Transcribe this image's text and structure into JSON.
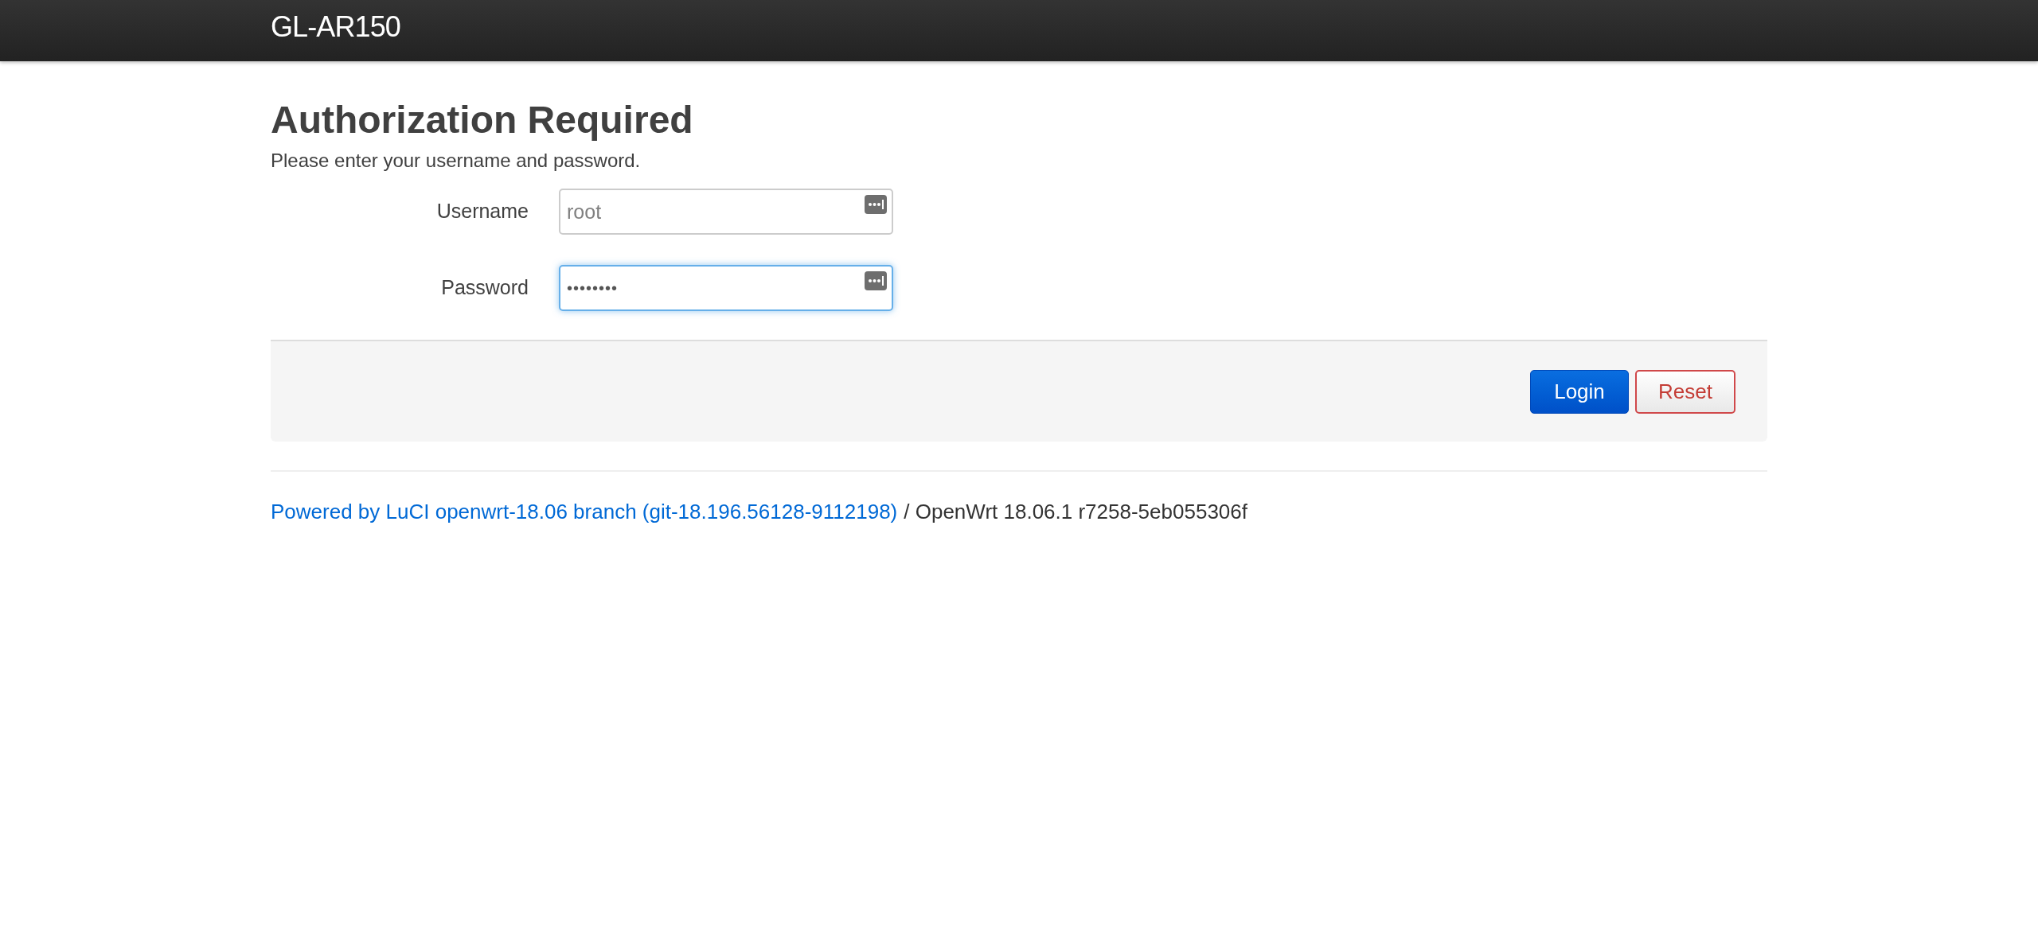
{
  "header": {
    "brand": "GL-AR150"
  },
  "title": "Authorization Required",
  "description": "Please enter your username and password.",
  "fields": [
    {
      "label": "Username",
      "value": "root",
      "kind": "text",
      "focused": false
    },
    {
      "label": "Password",
      "value": "••••••••",
      "kind": "password",
      "focused": true
    }
  ],
  "buttons": [
    {
      "label": "Login",
      "kind": "primary"
    },
    {
      "label": "Reset",
      "kind": "reset"
    }
  ],
  "footer": {
    "link": "Powered by LuCI openwrt-18.06 branch (git-18.196.56128-9112198)",
    "text": "/ OpenWrt 18.06.1 r7258-5eb055306f"
  }
}
